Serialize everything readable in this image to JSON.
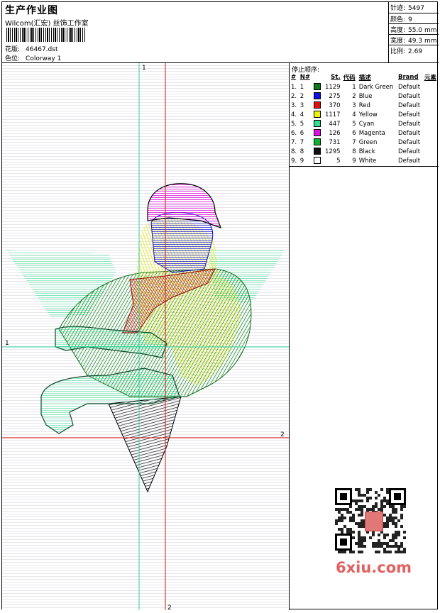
{
  "header": {
    "title": "生产作业图",
    "studio": "Wilcom(汇宏) 丝饰工作室",
    "design_label": "花版:",
    "design_value": "46467.dst",
    "colorway_label": "色位:",
    "colorway_value": "Colorway 1"
  },
  "stats": [
    {
      "label": "针迹:",
      "value": "5497"
    },
    {
      "label": "颜色:",
      "value": "9"
    },
    {
      "label": "高度:",
      "value": "55.0 mm"
    },
    {
      "label": "宽度:",
      "value": "49.3 mm"
    },
    {
      "label": "比例:",
      "value": "2.69"
    }
  ],
  "stop_sequence": {
    "title": "停止顺序:",
    "headers": [
      "#",
      "N#",
      "St.",
      "代码",
      "描述",
      "Brand",
      "元素"
    ],
    "rows": [
      {
        "idx": "1.",
        "n": "1",
        "color": "#0a7a1a",
        "st": "1129",
        "code": "1",
        "desc": "Dark Green",
        "brand": "Default"
      },
      {
        "idx": "2.",
        "n": "2",
        "color": "#1010e0",
        "st": "275",
        "code": "2",
        "desc": "Blue",
        "brand": "Default"
      },
      {
        "idx": "3.",
        "n": "3",
        "color": "#e01010",
        "st": "370",
        "code": "3",
        "desc": "Red",
        "brand": "Default"
      },
      {
        "idx": "4.",
        "n": "4",
        "color": "#f0f010",
        "st": "1117",
        "code": "4",
        "desc": "Yellow",
        "brand": "Default"
      },
      {
        "idx": "5.",
        "n": "5",
        "color": "#30e090",
        "st": "447",
        "code": "5",
        "desc": "Cyan",
        "brand": "Default"
      },
      {
        "idx": "6.",
        "n": "6",
        "color": "#e010e0",
        "st": "126",
        "code": "6",
        "desc": "Magenta",
        "brand": "Default"
      },
      {
        "idx": "7.",
        "n": "7",
        "color": "#10b030",
        "st": "731",
        "code": "7",
        "desc": "Green",
        "brand": "Default"
      },
      {
        "idx": "8.",
        "n": "8",
        "color": "#101010",
        "st": "1295",
        "code": "8",
        "desc": "Black",
        "brand": "Default"
      },
      {
        "idx": "9.",
        "n": "9",
        "color": "#ffffff",
        "st": "5",
        "code": "9",
        "desc": "White",
        "brand": "Default"
      }
    ]
  },
  "guides": {
    "h1": "1",
    "h2": "2",
    "v1": "1",
    "v2": "2"
  },
  "watermark": "6xiu.com"
}
